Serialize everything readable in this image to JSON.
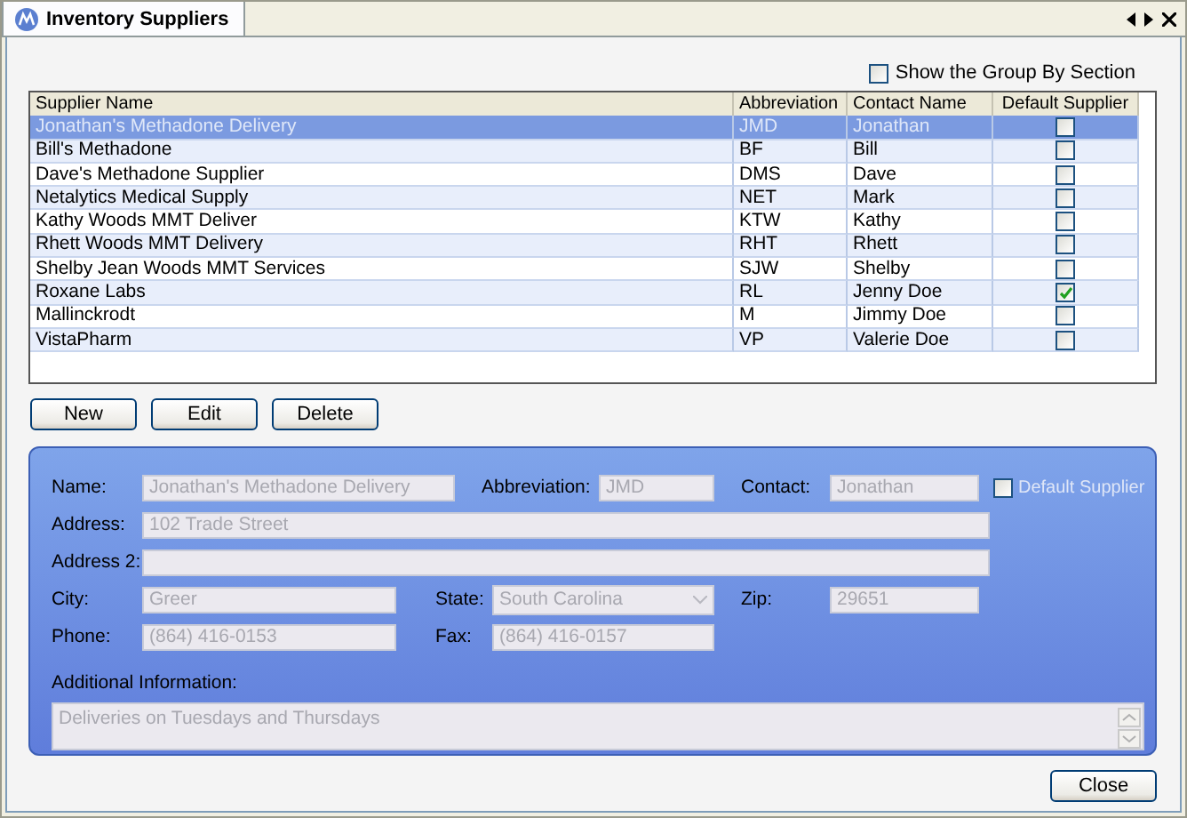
{
  "window": {
    "title": "Inventory Suppliers"
  },
  "group_by": {
    "label": "Show the Group By Section",
    "checked": false
  },
  "table": {
    "columns": [
      "Supplier Name",
      "Abbreviation",
      "Contact Name",
      "Default Supplier"
    ],
    "rows": [
      {
        "name": "Jonathan's Methadone Delivery",
        "abbr": "JMD",
        "contact": "Jonathan",
        "default": false,
        "selected": true
      },
      {
        "name": "Bill's Methadone",
        "abbr": "BF",
        "contact": "Bill",
        "default": false,
        "selected": false
      },
      {
        "name": "Dave's Methadone Supplier",
        "abbr": "DMS",
        "contact": "Dave",
        "default": false,
        "selected": false
      },
      {
        "name": "Netalytics Medical Supply",
        "abbr": "NET",
        "contact": "Mark",
        "default": false,
        "selected": false
      },
      {
        "name": "Kathy Woods MMT Deliver",
        "abbr": "KTW",
        "contact": "Kathy",
        "default": false,
        "selected": false
      },
      {
        "name": "Rhett Woods MMT Delivery",
        "abbr": "RHT",
        "contact": "Rhett",
        "default": false,
        "selected": false
      },
      {
        "name": "Shelby Jean Woods MMT Services",
        "abbr": "SJW",
        "contact": "Shelby",
        "default": false,
        "selected": false
      },
      {
        "name": "Roxane Labs",
        "abbr": "RL",
        "contact": "Jenny Doe",
        "default": true,
        "selected": false
      },
      {
        "name": "Mallinckrodt",
        "abbr": "M",
        "contact": "Jimmy Doe",
        "default": false,
        "selected": false
      },
      {
        "name": "VistaPharm",
        "abbr": "VP",
        "contact": "Valerie Doe",
        "default": false,
        "selected": false
      }
    ]
  },
  "buttons": [
    "New",
    "Edit",
    "Delete"
  ],
  "details": {
    "name": {
      "label": "Name:",
      "value": "Jonathan's Methadone Delivery"
    },
    "abbreviation": {
      "label": "Abbreviation:",
      "value": "JMD"
    },
    "contact": {
      "label": "Contact:",
      "value": "Jonathan"
    },
    "default_supplier": {
      "label": "Default Supplier",
      "checked": false
    },
    "address": {
      "label": "Address:",
      "value": "102 Trade Street"
    },
    "address2": {
      "label": "Address 2:"
    },
    "city": {
      "label": "City:",
      "value": "Greer"
    },
    "state": {
      "label": "State:",
      "value": "South Carolina"
    },
    "zip": {
      "label": "Zip:",
      "value": "29651"
    },
    "phone": {
      "label": "Phone:",
      "value": "(864) 416-0153"
    },
    "fax": {
      "label": "Fax:",
      "value": "(864) 416-0157"
    },
    "additional": {
      "label": "Additional Information:",
      "value": "Deliveries on Tuesdays and Thursdays"
    }
  },
  "close_button": "Close"
}
